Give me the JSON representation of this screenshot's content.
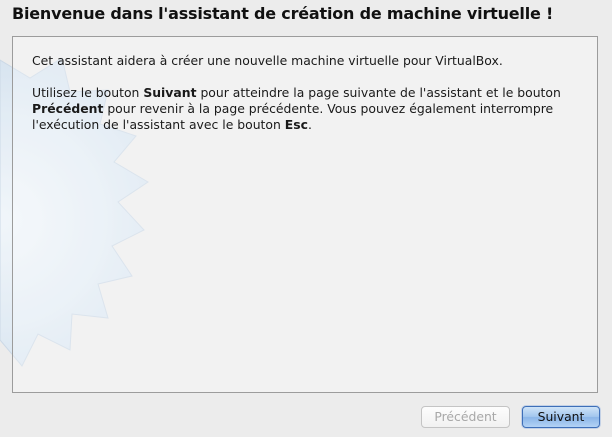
{
  "wizard": {
    "title": "Bienvenue dans l'assistant de création de machine virtuelle !",
    "intro": "Cet assistant aidera à créer une nouvelle machine virtuelle pour VirtualBox.",
    "instructions": {
      "part1": "Utilisez le bouton ",
      "next_word": "Suivant",
      "part2": " pour atteindre la page suivante de l'assistant et le bouton ",
      "prev_word": "Précédent",
      "part3": " pour revenir à la page précédente. Vous pouvez également interrompre l'exécution de l'assistant avec le bouton ",
      "esc_word": "Esc",
      "part4": "."
    }
  },
  "buttons": {
    "previous_label": "Précédent",
    "previous_enabled": false,
    "next_label": "Suivant",
    "next_enabled": true
  },
  "colors": {
    "background": "#ececec",
    "next_button_accent": "#8bb6e8",
    "watermark_fill": "#dbe8f3"
  }
}
